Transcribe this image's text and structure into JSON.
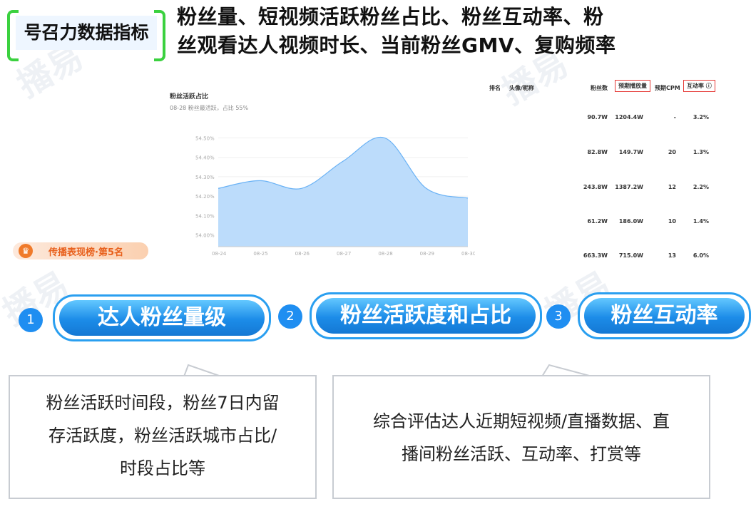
{
  "header": {
    "tag": "号召力数据指标",
    "headline_line1": "粉丝量、短视频活跃粉丝占比、粉丝互动率、粉",
    "headline_line2": "丝观看达人视频时长、当前粉丝GMV、复购频率"
  },
  "watermark": "播易",
  "chart": {
    "title": "粉丝活跃占比",
    "subtitle": "08-28 粉丝最活跃，占比 55%"
  },
  "chart_data": {
    "type": "area",
    "categories": [
      "08-24",
      "08-25",
      "08-26",
      "08-27",
      "08-28",
      "08-29",
      "08-30"
    ],
    "values": [
      54.24,
      54.28,
      54.24,
      54.38,
      54.5,
      54.24,
      54.19
    ],
    "y_ticks": [
      "54.50%",
      "54.40%",
      "54.30%",
      "54.20%",
      "54.10%",
      "54.00%"
    ],
    "ylim": [
      53.94,
      54.52
    ],
    "fill_color": "#bcdcfb",
    "line_color": "#6ab2f5"
  },
  "table": {
    "headers": [
      "排名",
      "头像/昵称",
      "粉丝数",
      "预期播放量",
      "预期CPM",
      "互动率 ⓘ"
    ],
    "rows": [
      [
        "90.7W",
        "1204.4W",
        "-",
        "3.2%"
      ],
      [
        "82.8W",
        "149.7W",
        "20",
        "1.3%"
      ],
      [
        "243.8W",
        "1387.2W",
        "12",
        "2.2%"
      ],
      [
        "61.2W",
        "186.0W",
        "10",
        "1.4%"
      ],
      [
        "663.3W",
        "715.0W",
        "13",
        "6.0%"
      ]
    ]
  },
  "badge": {
    "icon": "crown-icon",
    "label": "传播表现榜·第5名"
  },
  "steps": [
    {
      "num": "1",
      "label": "达人粉丝量级"
    },
    {
      "num": "2",
      "label": "粉丝活跃度和占比"
    },
    {
      "num": "3",
      "label": "粉丝互动率"
    }
  ],
  "notes": {
    "left": [
      "粉丝活跃时间段，粉丝7日内留",
      "存活跃度，粉丝活跃城市占比/",
      "时段占比等"
    ],
    "right": [
      "综合评估达人近期短视频/直播数据、直",
      "播间粉丝活跃、互动率、打赏等"
    ]
  },
  "colors": {
    "accent": "#1f8ef1",
    "tag_bracket": "#3bd13f",
    "highlight_box": "#e53935",
    "badge_text": "#e8601c"
  }
}
